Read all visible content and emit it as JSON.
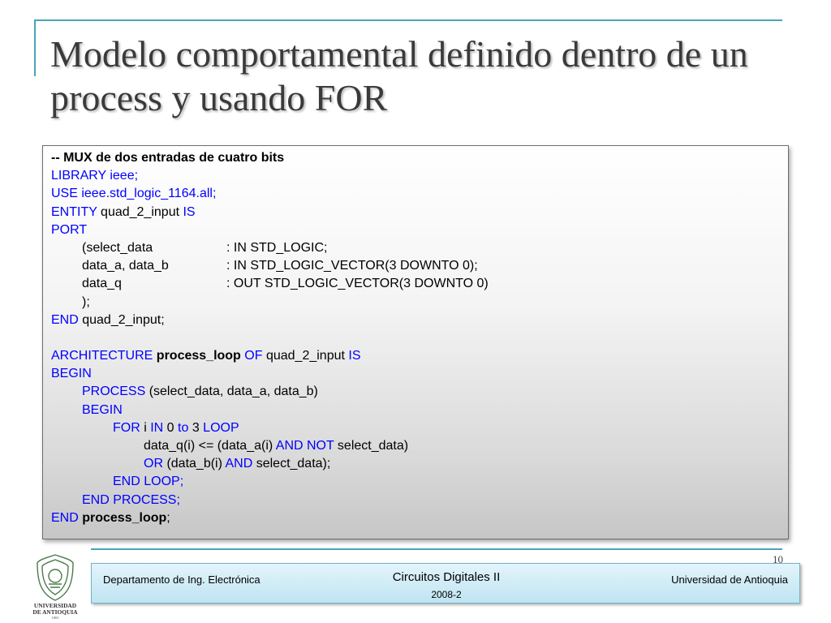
{
  "slide": {
    "title": "Modelo comportamental definido dentro de un process y usando FOR",
    "page_number": "10"
  },
  "code": {
    "comment": "-- MUX de dos entradas de cuatro bits",
    "library": "LIBRARY ieee;",
    "use": "USE ieee.std_logic_1164.all;",
    "entity_kw": "ENTITY",
    "entity_name": " quad_2_input ",
    "is_kw": "IS",
    "port_kw": "PORT",
    "ports": [
      {
        "name": "(select_data",
        "type": ": IN STD_LOGIC;"
      },
      {
        "name": "data_a, data_b",
        "type": ": IN STD_LOGIC_VECTOR(3 DOWNTO 0);"
      },
      {
        "name": "data_q",
        "type": ": OUT STD_LOGIC_VECTOR(3 DOWNTO 0)"
      }
    ],
    "port_close": ");",
    "end_kw": "END",
    "end_entity": " quad_2_input;",
    "arch_kw": "ARCHITECTURE",
    "arch_name": "process_loop",
    "of_kw": "OF",
    "arch_entity": " quad_2_input ",
    "begin_kw": "BEGIN",
    "process_kw": "PROCESS",
    "sensitivity": " (select_data, data_a, data_b)",
    "for_kw": "FOR",
    "for_var": " i ",
    "in_kw": "IN",
    "range_start": " 0 ",
    "to_kw": "to",
    "range_end": " 3 ",
    "loop_kw": "LOOP",
    "assign_part1": "data_q(i) <= (data_a(i) ",
    "and_kw": "AND",
    "not_kw": "NOT",
    "assign_part2": " select_data)",
    "or_kw": "OR",
    "assign_part3": " (data_b(i) ",
    "assign_part4": " select_data);",
    "end_loop": "END LOOP;",
    "end_process": "END PROCESS;",
    "end_arch_name": "process_loop",
    "semicolon": ";"
  },
  "footer": {
    "department": "Departamento de Ing. Electrónica",
    "course": "Circuitos Digitales II",
    "term": "2008-2",
    "university": "Universidad de Antioquia",
    "logo_text_line1": "UNIVERSIDAD",
    "logo_text_line2": "DE ANTIOQUIA",
    "logo_year": "1803"
  },
  "colors": {
    "keyword": "#0000ff",
    "accent": "#4aa3b8",
    "footer_bg": "#bfe4f2"
  }
}
